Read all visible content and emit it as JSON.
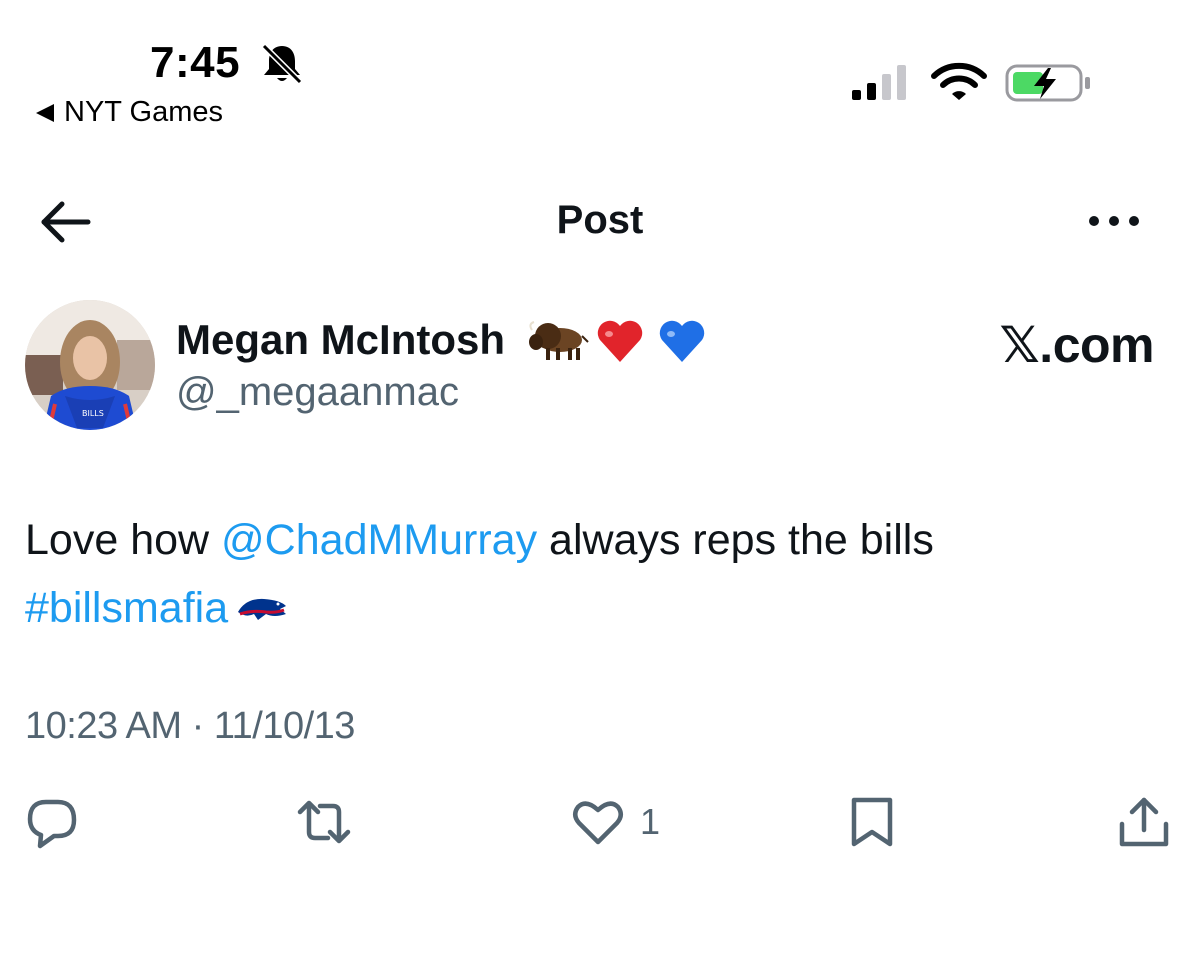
{
  "status_bar": {
    "time": "7:45",
    "back_app": "NYT Games",
    "icons": [
      "bell-slash-icon",
      "signal-icon",
      "wifi-icon",
      "battery-charging-icon"
    ],
    "battery_color": "#4cd964"
  },
  "nav": {
    "title": "Post",
    "back_icon": "arrow-left-icon",
    "more_icon": "more-horizontal-icon"
  },
  "post": {
    "author_name": "Megan McIntosh",
    "name_emojis": [
      "bison-emoji",
      "red-heart-emoji",
      "blue-heart-emoji"
    ],
    "handle": "@_megaanmac",
    "brand": "𝕏.com",
    "text_before": "Love how ",
    "mention": "@ChadMMurray",
    "text_after": " always reps the bills",
    "hashtag": "#billsmafia",
    "hashtag_icon": "buffalo-bills-logo",
    "timestamp": "10:23 AM · 11/10/13"
  },
  "actions": {
    "reply_icon": "reply-icon",
    "retweet_icon": "retweet-icon",
    "like_icon": "heart-icon",
    "like_count": "1",
    "bookmark_icon": "bookmark-icon",
    "share_icon": "share-icon"
  },
  "colors": {
    "link": "#1d9bf0",
    "text": "#0f1419",
    "secondary": "#536471"
  }
}
